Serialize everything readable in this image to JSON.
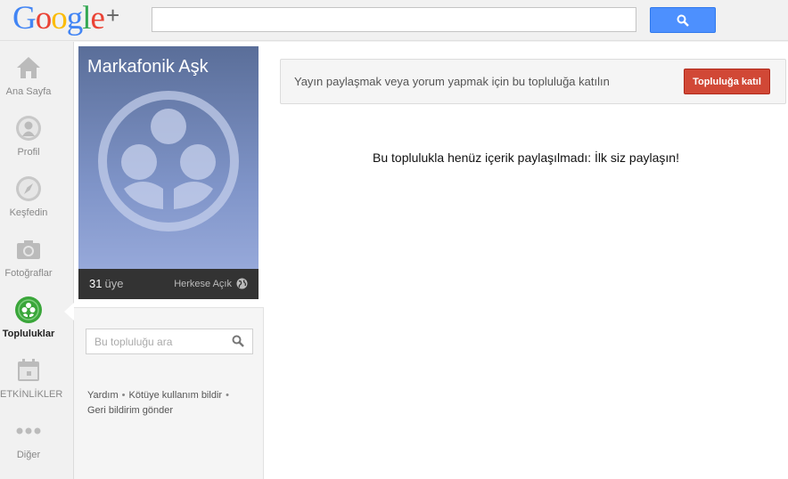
{
  "header": {
    "logo_letters": [
      "G",
      "o",
      "o",
      "g",
      "l",
      "e"
    ],
    "logo_plus": "+",
    "search_value": ""
  },
  "nav": {
    "items": [
      {
        "label": "Ana Sayfa",
        "icon": "home-icon"
      },
      {
        "label": "Profil",
        "icon": "profile-icon"
      },
      {
        "label": "Keşfedin",
        "icon": "compass-icon"
      },
      {
        "label": "Fotoğraflar",
        "icon": "camera-icon"
      },
      {
        "label": "Topluluklar",
        "icon": "communities-icon",
        "active": true
      },
      {
        "label": "ETKİNLİKLER",
        "icon": "calendar-icon"
      },
      {
        "label": "Diğer",
        "icon": "more-icon"
      }
    ]
  },
  "community": {
    "name": "Markafonik Aşk",
    "member_count": "31",
    "member_label": "üye",
    "visibility": "Herkese Açık",
    "search_placeholder": "Bu topluluğu ara"
  },
  "footer_links": {
    "help": "Yardım",
    "report_abuse": "Kötüye kullanım bildir",
    "feedback": "Geri bildirim gönder",
    "separator": "•"
  },
  "main": {
    "join_prompt": "Yayın paylaşmak veya yorum yapmak için bu topluluğa katılın",
    "join_button": "Topluluğa katıl",
    "empty_message": "Bu toplulukla henüz içerik paylaşılmadı: İlk siz paylaşın!"
  },
  "colors": {
    "join_button": "#d14836",
    "search_button": "#4d90fe",
    "active_nav": "#3aa63a"
  }
}
